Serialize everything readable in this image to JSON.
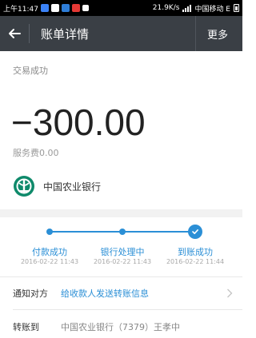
{
  "status_bar": {
    "time": "上午11:47",
    "speed": "21.9K/s",
    "carrier": "中国移动 E",
    "app_colors": [
      "#3b82f6",
      "#e74c3c",
      "#2e7dd7",
      "#e53935",
      "#ffffff"
    ]
  },
  "nav": {
    "title": "账单详情",
    "more_label": "更多",
    "background": "#3a3f45"
  },
  "transaction": {
    "status": "交易成功",
    "amount": "−300.00",
    "fee": "服务费0.00",
    "bank_name": "中国农业银行",
    "bank_color": "#0f8a6b"
  },
  "progress": {
    "accent": "#2b8fd6",
    "steps": [
      {
        "label": "付款成功",
        "time": "2016-02-22 11:43"
      },
      {
        "label": "银行处理中",
        "time": "2016-02-22 11:43"
      },
      {
        "label": "到账成功",
        "time": "2016-02-22 11:44"
      }
    ]
  },
  "rows": {
    "notify_label": "通知对方",
    "notify_value": "给收款人发送转账信息",
    "transfer_label": "转账到",
    "transfer_value": "中国农业银行（7379）王孝中"
  }
}
